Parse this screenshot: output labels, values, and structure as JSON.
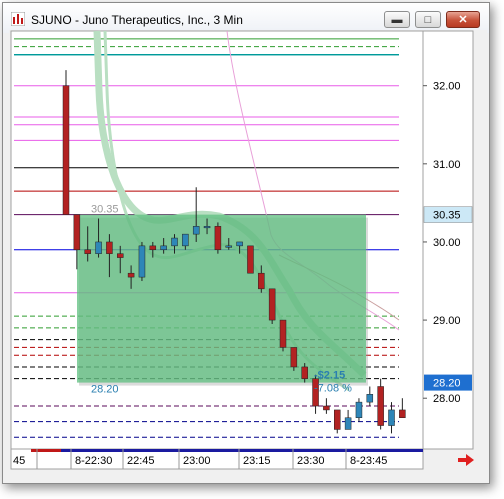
{
  "window": {
    "title": "SJUNO - Juno Therapeutics, Inc., 3 Min",
    "buttons": [
      "minimize",
      "maximize",
      "close"
    ]
  },
  "chart_data": {
    "type": "candlestick",
    "symbol": "SJUNO",
    "interval": "3 Min",
    "y_ticks": [
      32.0,
      31.0,
      30.0,
      29.0,
      28.0
    ],
    "y_tick_labels": [
      "32.00",
      "31.00",
      "30.00",
      "29.00",
      "28.00"
    ],
    "ylim": [
      27.35,
      32.7
    ],
    "x_tick_labels": [
      "45",
      "8-22:30",
      "22:45",
      "23:00",
      "23:15",
      "23:30",
      "8-23:45"
    ],
    "last_price_label": "30.35",
    "current_price_label": "28.20",
    "candles": [
      {
        "o": 32.0,
        "h": 32.2,
        "l": 30.35,
        "c": 30.35
      },
      {
        "o": 30.35,
        "h": 30.35,
        "l": 29.65,
        "c": 29.9
      },
      {
        "o": 29.9,
        "h": 30.2,
        "l": 29.75,
        "c": 29.85
      },
      {
        "o": 29.85,
        "h": 30.3,
        "l": 29.8,
        "c": 30.0
      },
      {
        "o": 30.0,
        "h": 30.1,
        "l": 29.55,
        "c": 29.85
      },
      {
        "o": 29.85,
        "h": 29.95,
        "l": 29.6,
        "c": 29.8
      },
      {
        "o": 29.6,
        "h": 29.7,
        "l": 29.4,
        "c": 29.55
      },
      {
        "o": 29.55,
        "h": 30.0,
        "l": 29.5,
        "c": 29.95
      },
      {
        "o": 29.95,
        "h": 30.0,
        "l": 29.8,
        "c": 29.9
      },
      {
        "o": 29.9,
        "h": 30.05,
        "l": 29.85,
        "c": 29.95
      },
      {
        "o": 29.95,
        "h": 30.1,
        "l": 29.85,
        "c": 30.05
      },
      {
        "o": 29.95,
        "h": 30.05,
        "l": 29.9,
        "c": 30.1
      },
      {
        "o": 30.1,
        "h": 30.7,
        "l": 30.0,
        "c": 30.2
      },
      {
        "o": 30.2,
        "h": 30.3,
        "l": 30.1,
        "c": 30.2
      },
      {
        "o": 30.2,
        "h": 30.25,
        "l": 29.85,
        "c": 29.9
      },
      {
        "o": 29.95,
        "h": 30.05,
        "l": 29.9,
        "c": 29.95
      },
      {
        "o": 29.95,
        "h": 30.0,
        "l": 29.85,
        "c": 30.0
      },
      {
        "o": 29.95,
        "h": 29.95,
        "l": 29.6,
        "c": 29.6
      },
      {
        "o": 29.6,
        "h": 29.7,
        "l": 29.35,
        "c": 29.4
      },
      {
        "o": 29.4,
        "h": 29.4,
        "l": 28.95,
        "c": 29.0
      },
      {
        "o": 29.0,
        "h": 29.0,
        "l": 28.6,
        "c": 28.65
      },
      {
        "o": 28.65,
        "h": 28.65,
        "l": 28.35,
        "c": 28.4
      },
      {
        "o": 28.4,
        "h": 28.45,
        "l": 28.2,
        "c": 28.25
      },
      {
        "o": 28.25,
        "h": 28.3,
        "l": 27.8,
        "c": 27.9
      },
      {
        "o": 27.9,
        "h": 28.0,
        "l": 27.8,
        "c": 27.85
      },
      {
        "o": 27.85,
        "h": 27.85,
        "l": 27.55,
        "c": 27.6
      },
      {
        "o": 27.6,
        "h": 27.85,
        "l": 27.6,
        "c": 27.75
      },
      {
        "o": 27.75,
        "h": 28.0,
        "l": 27.7,
        "c": 27.95
      },
      {
        "o": 27.95,
        "h": 28.15,
        "l": 27.9,
        "c": 28.05
      },
      {
        "o": 28.15,
        "h": 28.25,
        "l": 27.6,
        "c": 27.65
      },
      {
        "o": 27.65,
        "h": 27.95,
        "l": 27.55,
        "c": 27.85
      },
      {
        "o": 27.85,
        "h": 28.0,
        "l": 27.75,
        "c": 27.75
      }
    ],
    "horizontal_levels": [
      {
        "price": 32.6,
        "color": "#2e9c2e",
        "style": "solid"
      },
      {
        "price": 32.5,
        "color": "#2e9c2e",
        "style": "dashed"
      },
      {
        "price": 32.4,
        "color": "#009a9a",
        "style": "solid"
      },
      {
        "price": 32.0,
        "color": "#e85ce8",
        "style": "solid"
      },
      {
        "price": 31.6,
        "color": "#e85ce8",
        "style": "solid"
      },
      {
        "price": 31.5,
        "color": "#e85ce8",
        "style": "solid"
      },
      {
        "price": 31.3,
        "color": "#e85ce8",
        "style": "solid"
      },
      {
        "price": 30.95,
        "color": "#000000",
        "style": "solid"
      },
      {
        "price": 30.65,
        "color": "#b40000",
        "style": "solid"
      },
      {
        "price": 30.35,
        "color": "#5a0a5a",
        "style": "solid"
      },
      {
        "price": 29.9,
        "color": "#0000e0",
        "style": "solid"
      },
      {
        "price": 29.35,
        "color": "#e85ce8",
        "style": "solid"
      },
      {
        "price": 29.05,
        "color": "#2e9c2e",
        "style": "dashed"
      },
      {
        "price": 28.9,
        "color": "#2e9c2e",
        "style": "dashed"
      },
      {
        "price": 28.75,
        "color": "#000000",
        "style": "dashed"
      },
      {
        "price": 28.65,
        "color": "#b40000",
        "style": "dashed"
      },
      {
        "price": 28.55,
        "color": "#b40000",
        "style": "dashed"
      },
      {
        "price": 28.4,
        "color": "#000000",
        "style": "dashed"
      },
      {
        "price": 28.25,
        "color": "#000000",
        "style": "dashed"
      },
      {
        "price": 27.9,
        "color": "#5a0a5a",
        "style": "dashed"
      },
      {
        "price": 27.7,
        "color": "#00008b",
        "style": "dashed"
      },
      {
        "price": 27.5,
        "color": "#00008b",
        "style": "dashed"
      }
    ],
    "measure_box": {
      "start_price": 30.35,
      "end_price": 28.2,
      "start_label": "30.35",
      "end_label": "28.20",
      "change_label": "-$2.15",
      "percent_label": "-7.08 %",
      "color": "#5dbf7f"
    }
  },
  "colors": {
    "up_candle": "#2e86b8",
    "down_candle": "#b22222",
    "price_tag_bg": "#cce8f6",
    "current_tag_bg": "#1e6fd0"
  },
  "icons": {
    "app": "chart-app-icon",
    "scroll": "right-arrow-icon"
  }
}
